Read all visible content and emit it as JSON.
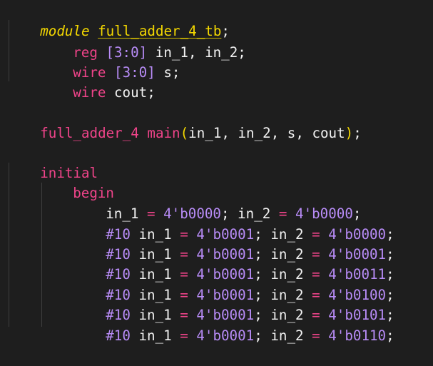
{
  "code_lines": [
    {
      "module_kw": "module",
      "module_name": "full_adder_4_tb",
      "end": ";"
    },
    {
      "kw": "reg",
      "range_open": "[",
      "range": "3:0",
      "range_close": "]",
      "rest": " in_1, in_2;"
    },
    {
      "kw": "wire",
      "range_open": "[",
      "range": "3:0",
      "range_close": "]",
      "rest": " s;"
    },
    {
      "kw": "wire",
      "rest": " cout;"
    },
    {
      "inst_module": "full_adder_4",
      "inst_name": " main",
      "open": "(",
      "args": "in_1, in_2, s, cout",
      "close": ")",
      "end": ";"
    },
    {
      "kw": "initial"
    },
    {
      "kw": "begin"
    },
    {
      "delay": "",
      "lhs1": "in_1",
      "val1": "4'b0000",
      "lhs2": "in_2",
      "val2": "4'b0000"
    },
    {
      "delay": "#10",
      "lhs1": "in_1",
      "val1": "4'b0001",
      "lhs2": "in_2",
      "val2": "4'b0000"
    },
    {
      "delay": "#10",
      "lhs1": "in_1",
      "val1": "4'b0001",
      "lhs2": "in_2",
      "val2": "4'b0001"
    },
    {
      "delay": "#10",
      "lhs1": "in_1",
      "val1": "4'b0001",
      "lhs2": "in_2",
      "val2": "4'b0011"
    },
    {
      "delay": "#10",
      "lhs1": "in_1",
      "val1": "4'b0001",
      "lhs2": "in_2",
      "val2": "4'b0100"
    },
    {
      "delay": "#10",
      "lhs1": "in_1",
      "val1": "4'b0001",
      "lhs2": "in_2",
      "val2": "4'b0101"
    },
    {
      "delay": "#10",
      "lhs1": "in_1",
      "val1": "4'b0001",
      "lhs2": "in_2",
      "val2": "4'b0110"
    }
  ],
  "operators": {
    "assign": "=",
    "semicolon": ";",
    "comma": ","
  },
  "colors": {
    "background": "#1e1e1e",
    "keyword": "#f0448a",
    "module": "#f5d900",
    "number": "#b88cf7",
    "identifier": "#f2f2f2"
  }
}
